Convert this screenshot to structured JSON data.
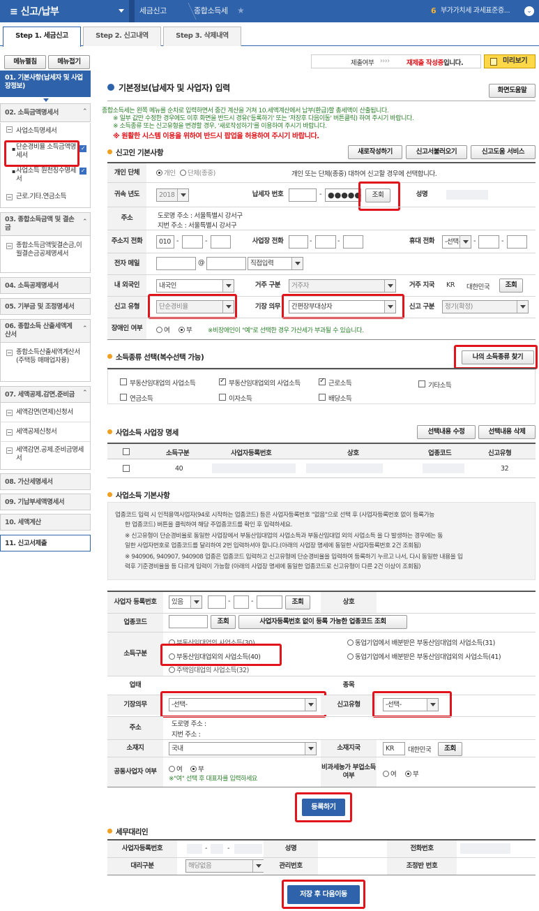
{
  "topbar": {
    "menu_title": "≡ 신고/납부",
    "crumb1": "세금신고",
    "crumb2": "종합소득세",
    "right_num": "6",
    "right_text": "부가가치세 과세표준증..."
  },
  "steps": [
    "Step 1. 세금신고",
    "Step 2. 신고내역",
    "Step 3. 삭제내역"
  ],
  "menu": {
    "open": "메뉴펼침",
    "close": "메뉴접기"
  },
  "sidebar": {
    "s01": "01. 기본사항(납세자 및 사업장정보)",
    "s02": "02. 소득금액명세서",
    "s02_items": [
      "사업소득명세서",
      "단순경비율 소득금액명세서",
      "사업소득 원천징수명세서",
      "근로.기타.연금소득"
    ],
    "s03": "03. 종합소득금액 및 결손금",
    "s03_item": "종합소득금액및결손금,이월결손금공제명세서",
    "s04": "04. 소득공제명세서",
    "s05": "05. 기부금 및 조정명세서",
    "s06": "06. 종합소득 산출세액계산서",
    "s06_item": "종합소득산출세액계산서(주택등 매매업자용)",
    "s07": "07. 세액공제.감면.준비금",
    "s07_items": [
      "세액감면(면제)신청서",
      "세액공제신청서",
      "세액감면.공제.준비금명세서"
    ],
    "s08": "08. 가산세명세서",
    "s09": "09. 기납부세액명세서",
    "s10": "10. 세액계산",
    "s11": "11. 신고서제출"
  },
  "status": {
    "label": "제출여부",
    "arrows": "››››",
    "value_red": "재제출 작성중",
    "value_tail": "입니다.",
    "preview": "미리보기"
  },
  "header": {
    "title": "기본정보(납세자 및 사업자) 입력",
    "help": "화면도움말"
  },
  "notice": {
    "line1": "종합소득세는 왼쪽 메뉴를 순차로 입력하면서 중간 계산을 거쳐 10.세액계산에서 납부(환급)할 총세액이 산출됩니다.",
    "line2": "※ 일부 값만 수정한 경우에도 이후 화면을 반드시 경유('등록하기' 또는 '저장후 다음이동' 버튼클릭) 하여 주시기 바랍니다.",
    "line3": "※ 소득종류 또는 신고유형을 변경할 경우, '새로작성하기'를 이용하여 주시기 바랍니다.",
    "line4": "※ 원활한 시스템 이용을 위하여 반드시 팝업을 허용하여 주시기 바랍니다."
  },
  "basic": {
    "title": "신고인 기본사항",
    "btn_new": "새로작성하기",
    "btn_load": "신고서불러오기",
    "btn_service": "신고도움 서비스",
    "l_type": "개인 단체",
    "r_individual": "개인",
    "r_group": "단체(종중)",
    "type_desc": "개인 또는 단체(종중) 대하여 신고할 경우에 선택합니다.",
    "l_year": "귀속 년도",
    "year": "2018",
    "l_tin": "납세자 번호",
    "tin_mask": "●●●●●",
    "btn_lookup": "조회",
    "l_name": "성명",
    "l_addr": "주소",
    "addr_road": "도로명 주소 : 서울특별시 강서구",
    "addr_lot": "지번 주소 : 서울특별시 강서구",
    "l_phone": "주소지 전화",
    "phone1": "010",
    "l_bizphone": "사업장 전화",
    "l_mobile": "휴대 전화",
    "mobile_sel": "-선택-",
    "l_email": "전자 메일",
    "at": "@",
    "email_sel": "직접입력",
    "l_foreign": "내 외국인",
    "foreign": "내국인",
    "l_resid": "거주 구분",
    "resid": "거주자",
    "l_country": "거주 지국",
    "country_code": "KR",
    "country_name": "대한민국",
    "btn_country": "조회",
    "l_rtype": "신고 유형",
    "rtype": "단순경비율",
    "l_book": "기장 의무",
    "book": "간편장부대상자",
    "l_rkind": "신고 구분",
    "rkind": "정기(확정)",
    "l_disabled": "장애인 여부",
    "yes": "여",
    "no": "부",
    "disabled_note": "※비장애인이 \"예\"로 선택한 경우 가산세가 부과될 수 있습니다."
  },
  "income": {
    "title": "소득종류 선택(복수선택 가능)",
    "btn_find": "나의 소득종류 찾기",
    "items": [
      "부동산임대업의 사업소득",
      "부동산임대업외의 사업소득",
      "근로소득",
      "기타소득",
      "연금소득",
      "이자소득",
      "배당소득"
    ]
  },
  "biz_list": {
    "title": "사업소득 사업장 명세",
    "btn_edit": "선택내용 수정",
    "btn_del": "선택내용 삭제",
    "headers": [
      "소득구분",
      "사업자등록번호",
      "상호",
      "업종코드",
      "신고유형"
    ],
    "row": {
      "income": "40",
      "rtype": "32"
    }
  },
  "biz_basic": {
    "title": "사업소득 기본사항",
    "info1": "업종코드 입력 시 인적용역사업자(94로 시작하는 업종코드) 등은 사업자등록번호 \"없음\"으로 선택 후 (사업자등록번호 없이 등록가능",
    "info2": "한 업종코드) 버튼을 클릭하여 해당 주업종코드를 확인 후 입력하세요.",
    "info3": "※ 신고유형이 단순경비율로 동일한 사업장에서 부동산임대업의 사업소득과 부동산임대업 외의 사업소득 을 다 발생하는 경우에는 동",
    "info4": "일한 사업자번호로 업종코드를 달리하여 2번 입력하셔야 합니다.(아래의 사업장 명세에 동일한 사업자등록번호 2건 조회됨)",
    "info5": "※ 940906, 940907, 940908 업종은 업종코드 입력하고 신고유형에 단순경비율을 입력하여 등록하기 누르고 나서, 다시 동일한 내용을 입",
    "info6": "력후 기준경비율을 등 다르게 입력이 가능함 (아래의 사업장 명세에 동일한 업종코드로 신고유형이 다른 2건 이상이 조회됨)",
    "l_bizno": "사업자 등록번호",
    "bizno_sel": "있음",
    "btn_lookup": "조회",
    "l_trade": "상호",
    "l_code": "업종코드",
    "btn_code": "조회",
    "btn_code_nobiz": "사업자등록번호 없이 등록 가능한 업종코드 조회",
    "l_kind": "소득구분",
    "k30": "부동산임대업의 사업소득(30)",
    "k40": "부동산임대업외의 사업소득(40)",
    "k32": "주택임대업의 사업소득(32)",
    "k31": "동업기업에서 배분받은 부동산임대업의 사업소득(31)",
    "k41": "동업기업에서 배분받은 부동산임대업외의 사업소득(41)",
    "l_biz": "업태",
    "l_item": "종목",
    "l_book": "기장의무",
    "book_sel": "-선택-",
    "l_rtype": "신고유형",
    "rtype_sel": "-선택-",
    "l_addr": "주소",
    "addr_road": "도로명 주소 :",
    "addr_lot": "지번 주소 :",
    "l_loc": "소재지",
    "loc": "국내",
    "l_loc_country": "소재지국",
    "loc_code": "KR",
    "loc_name": "대한민국",
    "btn_loc": "조회",
    "l_joint": "공동사업자 여부",
    "yes": "여",
    "no": "부",
    "joint_note": "※\"여\" 선택 후 대표자를 입력하세요",
    "l_nontax": "비과세농가 부업소득 여부",
    "btn_register": "등록하기"
  },
  "agent": {
    "title": "세무대리인",
    "l_bizno": "사업자등록번호",
    "l_name": "성명",
    "l_phone": "전화번호",
    "l_kind": "대리구분",
    "kind": "해당없음",
    "l_mgmt": "관리번호",
    "l_adj": "조정반 번호"
  },
  "save_next": "저장 후 다음이동"
}
